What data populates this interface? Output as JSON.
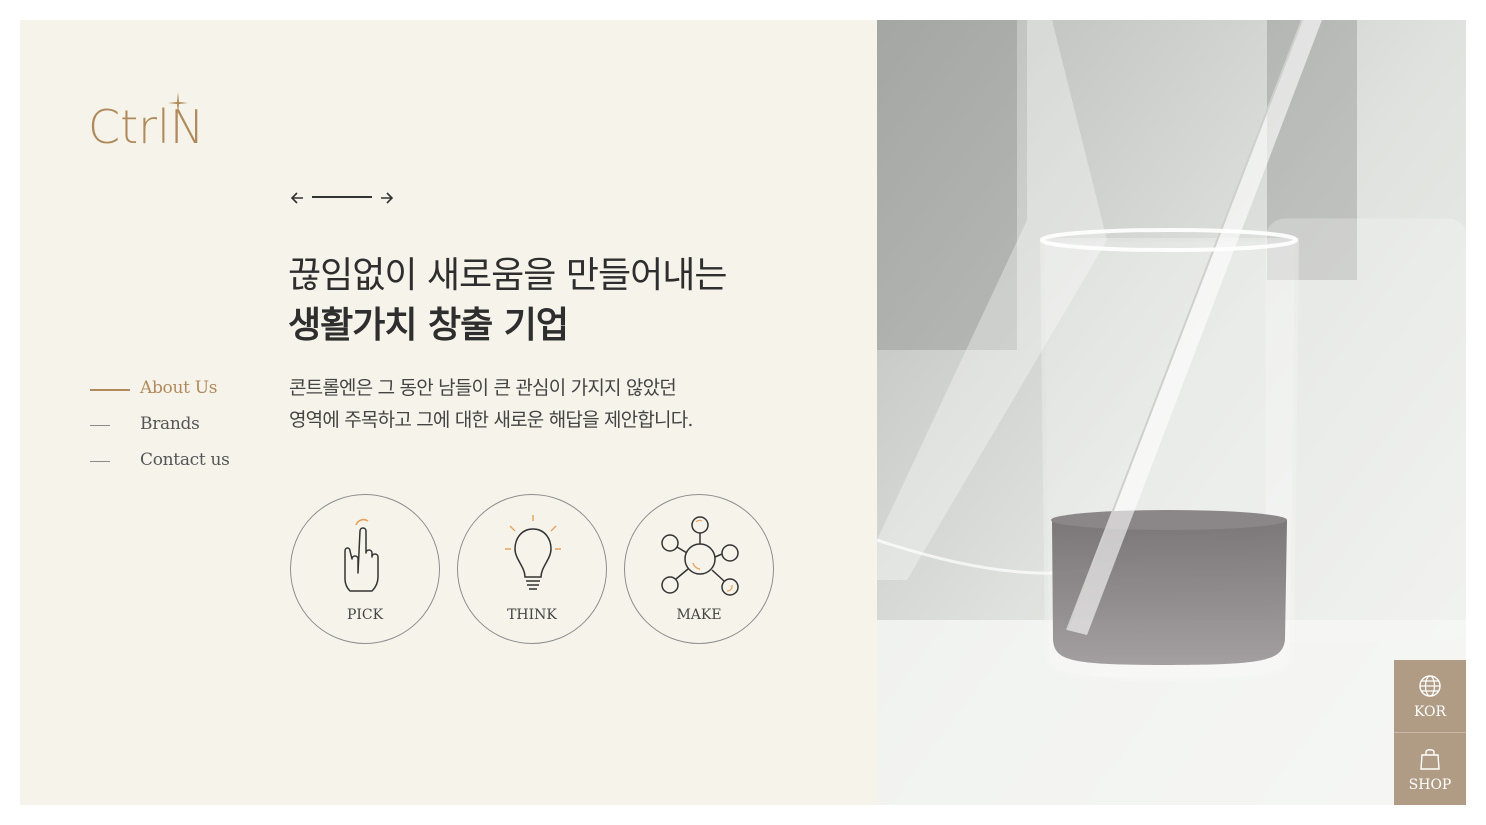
{
  "logo": {
    "text": "CtrlN"
  },
  "slider": {
    "prev_label": "previous",
    "next_label": "next"
  },
  "headline": {
    "line1": "끊임없이 새로움을 만들어내는",
    "line2": "생활가치 창출 기업"
  },
  "description": {
    "line1": "콘트롤엔은 그 동안 남들이 큰 관심이 가지지 않았던",
    "line2": "영역에 주목하고 그에 대한 새로운 해답을 제안합니다."
  },
  "nav": {
    "items": [
      {
        "label": "About Us",
        "active": true
      },
      {
        "label": "Brands",
        "active": false
      },
      {
        "label": "Contact us",
        "active": false
      }
    ]
  },
  "features": [
    {
      "label": "PICK",
      "icon": "pointing-hand-icon"
    },
    {
      "label": "THINK",
      "icon": "lightbulb-icon"
    },
    {
      "label": "MAKE",
      "icon": "network-icon"
    }
  ],
  "side_buttons": {
    "language": {
      "label": "KOR",
      "icon": "globe-icon"
    },
    "shop": {
      "label": "SHOP",
      "icon": "shopping-bag-icon"
    }
  },
  "colors": {
    "brand": "#b08a5c",
    "background": "#f6f4ea",
    "side_button": "#b09c85",
    "text": "#2e2e2e"
  }
}
